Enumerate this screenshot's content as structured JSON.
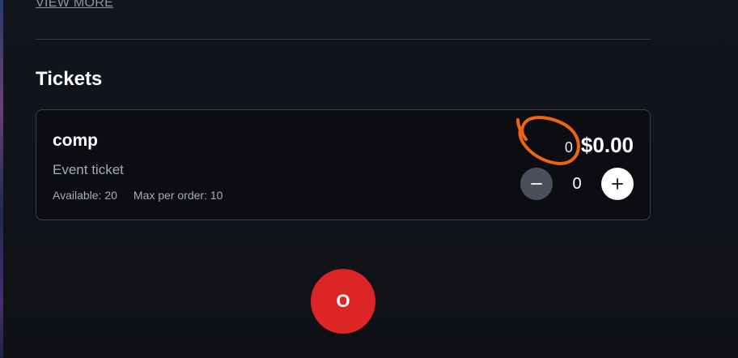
{
  "view_more_label": "VIEW MORE",
  "section_title": "Tickets",
  "ticket": {
    "name": "comp",
    "type": "Event ticket",
    "available": "Available: 20",
    "max_per_order": "Max per order: 10",
    "small_count": "0",
    "price": "$0.00",
    "quantity": "0"
  },
  "fab_label": "O",
  "colors": {
    "background": "#111319",
    "card_border": "#3a3f4b",
    "minus_button": "#4a4f5b",
    "plus_button": "#ffffff",
    "annotation": "#f0640f",
    "fab": "#dc2626"
  },
  "icons": {
    "decrement": "minus-icon",
    "increment": "plus-icon"
  }
}
